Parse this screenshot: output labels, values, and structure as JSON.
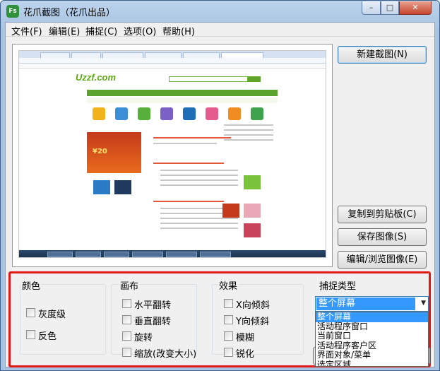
{
  "window": {
    "title": "花爪截图（花爪出品）",
    "icon_text": "Fs",
    "icon": "app-logo-icon",
    "caption_buttons": {
      "minimize": "–",
      "maximize": "□",
      "close": "✕"
    }
  },
  "menu": [
    "文件(F)",
    "编辑(E)",
    "捕捉(C)",
    "选项(O)",
    "帮助(H)"
  ],
  "preview": {
    "site_logo": "Uzzf.com",
    "banner_text": "¥20"
  },
  "buttons": {
    "new_capture": "新建截图(N)",
    "copy_clipboard": "复制到剪贴板(C)",
    "save_image": "保存图像(S)",
    "edit_browse": "编辑/浏览图像(E)"
  },
  "groups": {
    "color": {
      "title": "颜色",
      "items": [
        "灰度级",
        "反色"
      ]
    },
    "canvas": {
      "title": "画布",
      "items": [
        "水平翻转",
        "垂直翻转",
        "旋转",
        "缩放(改变大小)"
      ]
    },
    "effects": {
      "title": "效果",
      "items": [
        "X向倾斜",
        "Y向倾斜",
        "模糊",
        "锐化"
      ]
    },
    "capture_type": {
      "title": "捕捉类型",
      "selected": "整个屏幕",
      "options": [
        "整个屏幕",
        "活动程序窗口",
        "当前窗口",
        "活动程序客户区",
        "界面对象/菜单",
        "选定区域"
      ]
    }
  },
  "colors": {
    "highlight_border": "#e01818",
    "selection": "#3399ff",
    "site_green": "#5aa42d"
  }
}
